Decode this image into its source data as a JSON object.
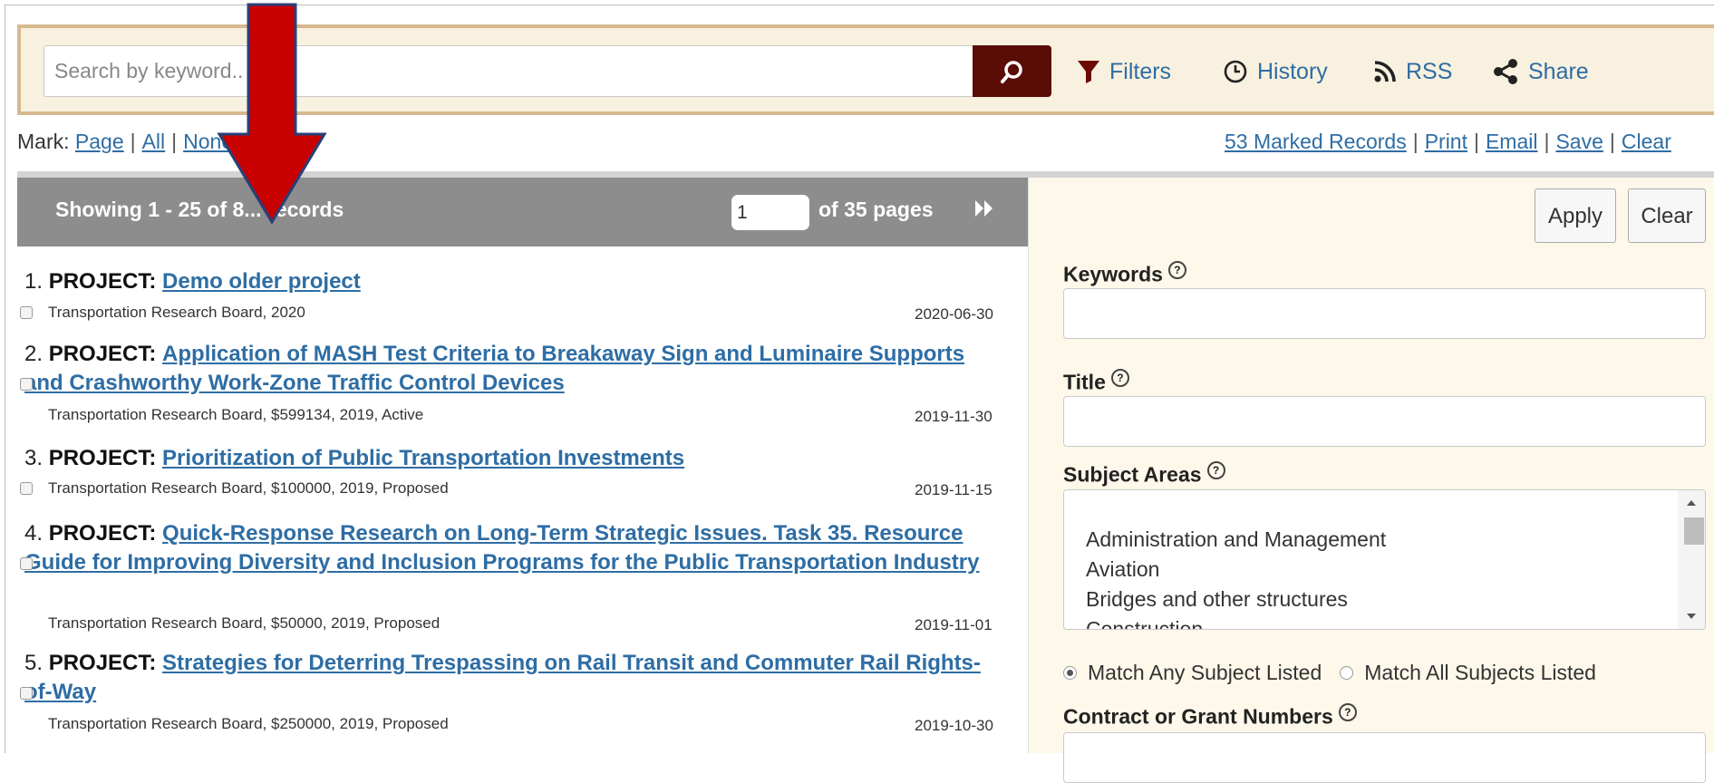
{
  "search": {
    "placeholder": "Search by keyword..",
    "tools": [
      {
        "label": "Filters",
        "icon": "filter-icon"
      },
      {
        "label": "History",
        "icon": "clock-icon"
      },
      {
        "label": "RSS",
        "icon": "rss-icon"
      },
      {
        "label": "Share",
        "icon": "share-icon"
      }
    ]
  },
  "mark": {
    "prefix": "Mark:",
    "page": "Page",
    "all": "All",
    "none": "None",
    "marked_records": "53 Marked Records",
    "print": "Print",
    "email": "Email",
    "save": "Save",
    "clear": "Clear"
  },
  "results_header": {
    "showing": "Showing 1 - 25 of 8... records",
    "page_value": "1",
    "of_pages": "of 35 pages"
  },
  "records": [
    {
      "num": "1.",
      "type": "PROJECT:",
      "title": "Demo older project",
      "meta": "Transportation Research Board, 2020",
      "date": "2020-06-30"
    },
    {
      "num": "2.",
      "type": "PROJECT:",
      "title": "Application of MASH Test Criteria to Breakaway Sign and Luminaire Supports and Crashworthy Work-Zone Traffic Control Devices",
      "meta": "Transportation Research Board, $599134, 2019, Active",
      "date": "2019-11-30"
    },
    {
      "num": "3.",
      "type": "PROJECT:",
      "title": "Prioritization of Public Transportation Investments",
      "meta": "Transportation Research Board, $100000, 2019, Proposed",
      "date": "2019-11-15"
    },
    {
      "num": "4.",
      "type": "PROJECT:",
      "title": "Quick-Response Research on Long-Term Strategic Issues. Task 35. Resource Guide for Improving Diversity and Inclusion Programs for the Public Transportation Industry",
      "meta": "Transportation Research Board, $50000, 2019, Proposed",
      "date": "2019-11-01"
    },
    {
      "num": "5.",
      "type": "PROJECT:",
      "title": "Strategies for Deterring Trespassing on Rail Transit and Commuter Rail Rights-of-Way",
      "meta": "Transportation Research Board, $250000, 2019, Proposed",
      "date": "2019-10-30"
    }
  ],
  "panel": {
    "apply": "Apply",
    "clear": "Clear",
    "keywords_label": "Keywords",
    "title_label": "Title",
    "subject_label": "Subject Areas",
    "subjects": [
      "Administration and Management",
      "Aviation",
      "Bridges and other structures",
      "Construction"
    ],
    "match_any": "Match Any Subject Listed",
    "match_all": "Match All Subjects Listed",
    "match_selected": "any",
    "contract_label": "Contract or Grant Numbers"
  },
  "colors": {
    "search_button": "#5a0c06",
    "link": "#2e6da4",
    "header_gray": "#8d8d8d",
    "arrow_red": "#c80000",
    "panel_bg": "#fdf8ea"
  }
}
